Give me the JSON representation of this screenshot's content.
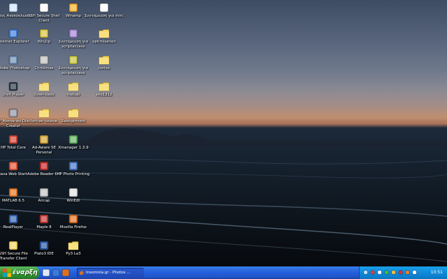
{
  "desktop": {
    "icons": [
      {
        "label": "Κάδος Ανακύκλωσης",
        "icon": "recycle-bin-icon",
        "color": "#cfe6ff"
      },
      {
        "label": "SSH Secure Shell Client",
        "icon": "ssh-client-icon",
        "color": "#ffffff"
      },
      {
        "label": "Winamp",
        "icon": "winamp-icon",
        "color": "#f0b030"
      },
      {
        "label": "Συντόμευση για mirc",
        "icon": "mirc-icon",
        "color": "#ffffff"
      },
      {
        "label": "Internet Explorer",
        "icon": "internet-explorer-icon",
        "color": "#3a7ad8"
      },
      {
        "label": "WinZip",
        "icon": "winzip-icon",
        "color": "#d8c040"
      },
      {
        "label": "Συντόμευση για scriptaccess",
        "icon": "shortcut-icon",
        "color": "#a080d0"
      },
      {
        "label": "optimization",
        "icon": "folder-icon",
        "color": "#f4d560"
      },
      {
        "label": "Adobe Photoshop",
        "icon": "photoshop-icon",
        "color": "#6a8ab0"
      },
      {
        "label": "Christmas",
        "icon": "christmas-icon",
        "color": "#c0c0c0"
      },
      {
        "label": "Συντόμευση για scriptaccess",
        "icon": "shortcut-icon",
        "color": "#c0c040"
      },
      {
        "label": "cortex",
        "icon": "folder-icon",
        "color": "#f4d560"
      },
      {
        "label": "DivX Player",
        "icon": "divx-player-icon",
        "color": "#203040"
      },
      {
        "label": "Downloads",
        "icon": "folder-icon",
        "color": "#f4d560"
      },
      {
        "label": "matlab",
        "icon": "folder-icon",
        "color": "#f4d560"
      },
      {
        "label": "eks1312",
        "icon": "folder-icon",
        "color": "#f4d560"
      },
      {
        "label": "HP Memories Disc Creator",
        "icon": "hp-memories-icon",
        "color": "#9090a0"
      },
      {
        "label": "fortran course",
        "icon": "folder-icon",
        "color": "#f4d560"
      },
      {
        "label": "2assignment",
        "icon": "folder-icon",
        "color": "#f4d560"
      },
      {
        "label": "HP Total Care",
        "icon": "hp-total-care-icon",
        "color": "#d04030"
      },
      {
        "label": "Ad-Aware SE Personal",
        "icon": "ad-aware-icon",
        "color": "#d0a030"
      },
      {
        "label": "Xmanager 1.3.9",
        "icon": "xmanager-icon",
        "color": "#60b060"
      },
      {
        "label": "Java Web Start",
        "icon": "java-icon",
        "color": "#e05030"
      },
      {
        "label": "Adobe Reader 6.0",
        "icon": "adobe-reader-icon",
        "color": "#c02020"
      },
      {
        "label": "HP Photo Printing",
        "icon": "hp-photo-icon",
        "color": "#4070c0"
      },
      {
        "label": "MATLAB 6.5",
        "icon": "matlab-icon",
        "color": "#e07020"
      },
      {
        "label": "Aircap",
        "icon": "aircap-icon",
        "color": "#c0c0c0"
      },
      {
        "label": "WinEdt",
        "icon": "winedt-icon",
        "color": "#e0e0e0"
      },
      {
        "label": "RealPlayer",
        "icon": "realplayer-icon",
        "color": "#3060b0"
      },
      {
        "label": "Maple 8",
        "icon": "maple-icon",
        "color": "#c03030"
      },
      {
        "label": "Mozilla Firefox",
        "icon": "firefox-icon",
        "color": "#e07020"
      },
      {
        "label": "SSH Secure File Transfer Client",
        "icon": "ssh-file-transfer-icon",
        "color": "#f4d560"
      },
      {
        "label": "Plato3 IDE",
        "icon": "plato-ide-icon",
        "color": "#2050a0"
      },
      {
        "label": "Py3 La3",
        "icon": "folder-icon",
        "color": "#f4d560"
      }
    ]
  },
  "taskbar": {
    "start_label": "έναρξη",
    "quicklaunch": [
      {
        "icon": "show-desktop-icon",
        "color": "#e0e8f8"
      },
      {
        "icon": "internet-explorer-icon",
        "color": "#3a7ad8"
      },
      {
        "icon": "firefox-icon",
        "color": "#e07020"
      }
    ],
    "task_button_label": "Insomnia.gr - Photos ...",
    "task_button_icon": "firefox-icon",
    "tray_icons": [
      {
        "icon": "network-icon",
        "color": "#c0e0ff"
      },
      {
        "icon": "antivirus-icon",
        "color": "#e04040"
      },
      {
        "icon": "volume-icon",
        "color": "#ffffff"
      },
      {
        "icon": "messenger-icon",
        "color": "#40c040"
      },
      {
        "icon": "update-icon",
        "color": "#f0c040"
      },
      {
        "icon": "security-shield-icon",
        "color": "#e03030"
      },
      {
        "icon": "java-icon",
        "color": "#f08030"
      },
      {
        "icon": "hp-icon",
        "color": "#ffffff"
      }
    ],
    "clock": "10:51"
  },
  "colors": {
    "taskbar_blue": "#245edb",
    "start_green": "#3c9c3c",
    "tray_blue": "#0f8ad8"
  }
}
